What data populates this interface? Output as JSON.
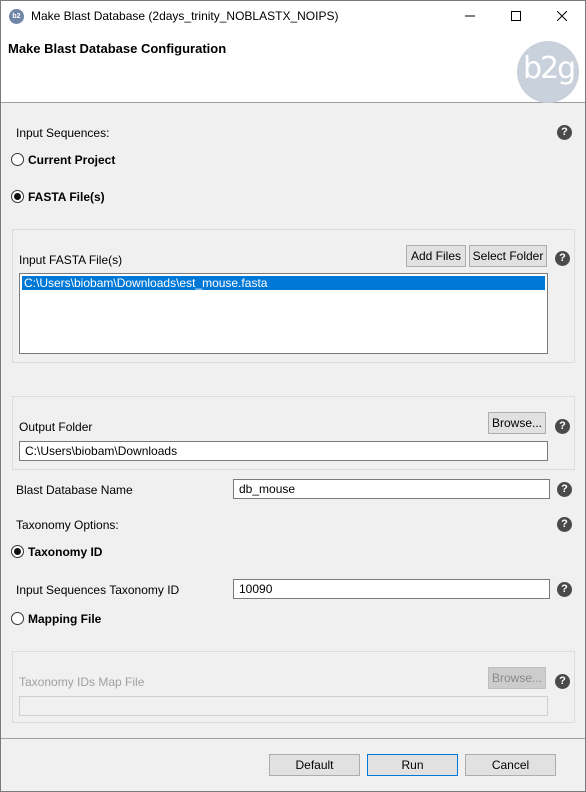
{
  "window": {
    "title": "Make Blast Database (2days_trinity_NOBLASTX_NOIPS)",
    "app_icon": "b2g-app-icon"
  },
  "header": {
    "title": "Make Blast Database Configuration",
    "logo_text": "b2g"
  },
  "input_sequences": {
    "label": "Input Sequences:",
    "options": [
      {
        "label": "Current Project",
        "selected": false
      },
      {
        "label": "FASTA File(s)",
        "selected": true
      }
    ]
  },
  "fasta_group": {
    "label": "Input FASTA File(s)",
    "add_files_label": "Add Files",
    "select_folder_label": "Select Folder",
    "files": [
      "C:\\Users\\biobam\\Downloads\\est_mouse.fasta"
    ]
  },
  "output_folder": {
    "label": "Output Folder",
    "browse_label": "Browse...",
    "value": "C:\\Users\\biobam\\Downloads"
  },
  "blast_db_name": {
    "label": "Blast Database Name",
    "value": "db_mouse"
  },
  "taxonomy": {
    "label": "Taxonomy Options:",
    "taxonomy_id_option": "Taxonomy ID",
    "taxonomy_id_selected": true,
    "seq_taxonomy_label": "Input Sequences Taxonomy ID",
    "seq_taxonomy_value": "10090",
    "mapping_file_option": "Mapping File",
    "mapping_file_selected": false,
    "map_file_label": "Taxonomy IDs Map File",
    "map_browse_label": "Browse...",
    "map_file_value": ""
  },
  "footer": {
    "default_label": "Default",
    "run_label": "Run",
    "cancel_label": "Cancel"
  },
  "help_glyph": "?"
}
